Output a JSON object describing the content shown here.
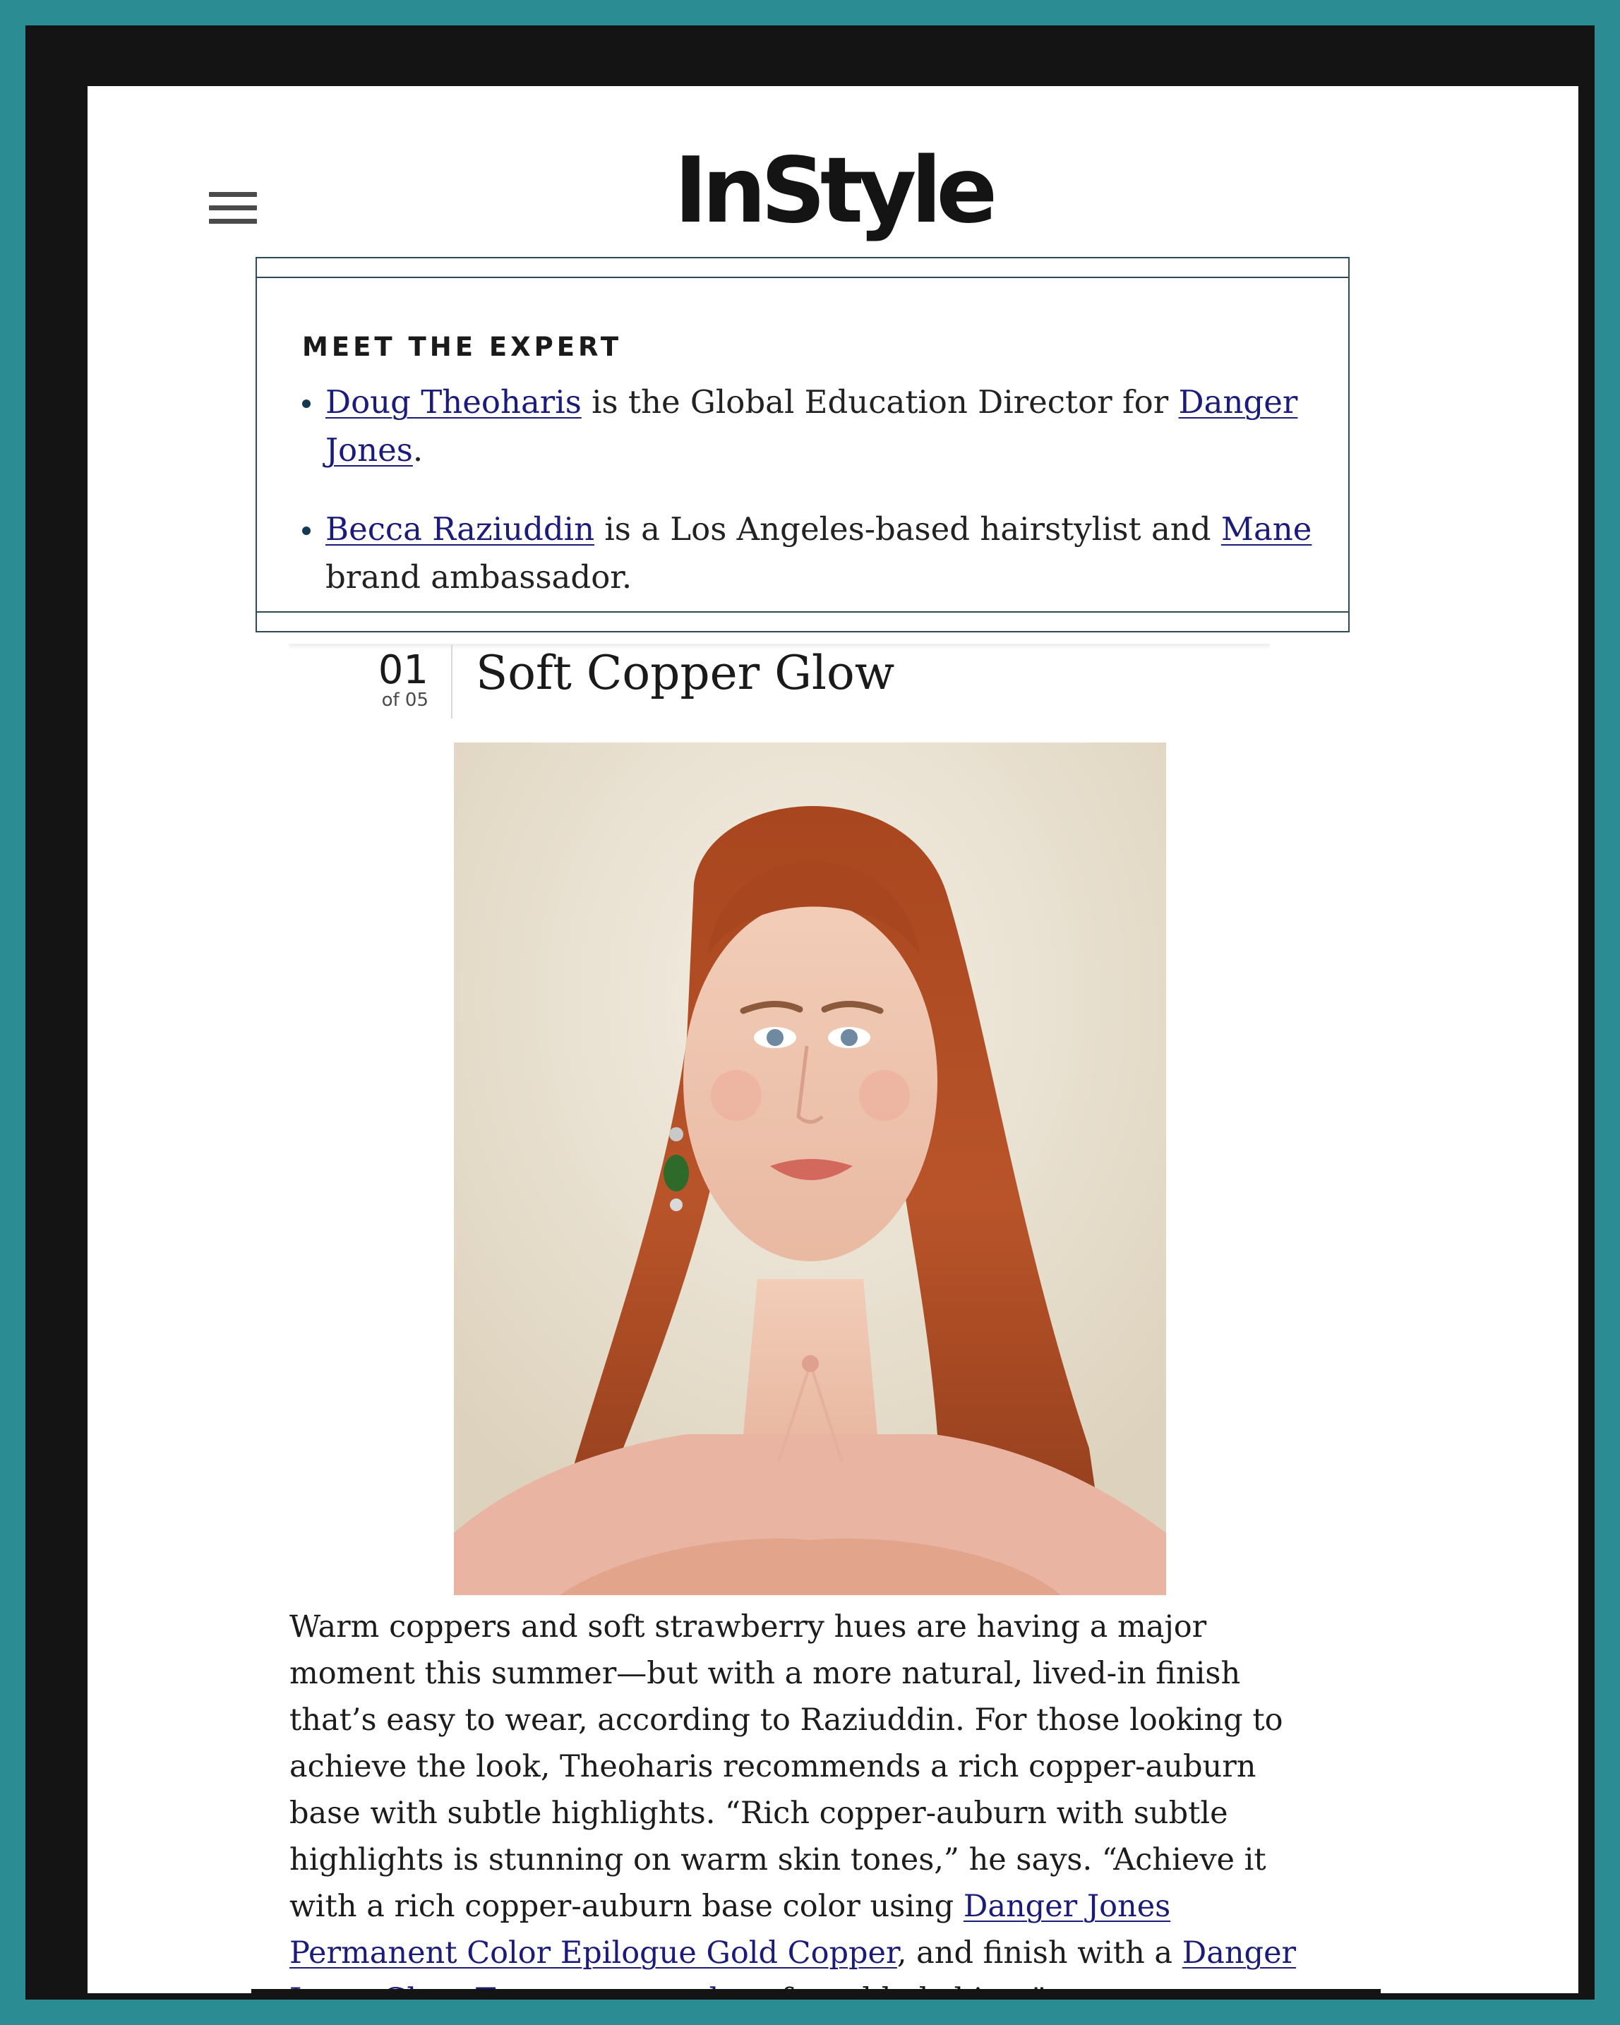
{
  "header": {
    "logo_text": "InStyle",
    "menu_icon": "hamburger-menu-icon"
  },
  "expert_box": {
    "heading": "MEET THE EXPERT",
    "items": [
      {
        "link1": "Doug Theoharis",
        "text1": " is the Global Education Director for ",
        "link2": "Danger Jones",
        "text2": "."
      },
      {
        "link1": "Becca Raziuddin",
        "text1": " is a Los Angeles-based hairstylist and ",
        "link2": "Mane",
        "text2": " brand ambassador."
      }
    ]
  },
  "list_item": {
    "number": "01",
    "of_label": "of 05",
    "title": "Soft Copper Glow"
  },
  "article": {
    "p1": "Warm coppers and soft strawberry hues are having a major moment this summer—but with a more natural, lived-in finish that’s easy to wear, according to Raziuddin. For those looking to achieve the look, Theoharis recommends a rich copper-auburn base with subtle highlights. “Rich copper-auburn with subtle highlights is stunning on warm skin tones,” he says. “Achieve it with a rich copper-auburn base color using ",
    "link1": "Danger Jones Permanent Color Epilogue Gold Copper",
    "p2": ", and finish with a ",
    "link2": "Danger Jones Gloss Toner copper glaze",
    "p3": " for added shine.”"
  },
  "colors": {
    "background": "#2b8d93",
    "frame": "#141414",
    "link": "#1b1b7a",
    "box_border": "#2d4a58"
  }
}
